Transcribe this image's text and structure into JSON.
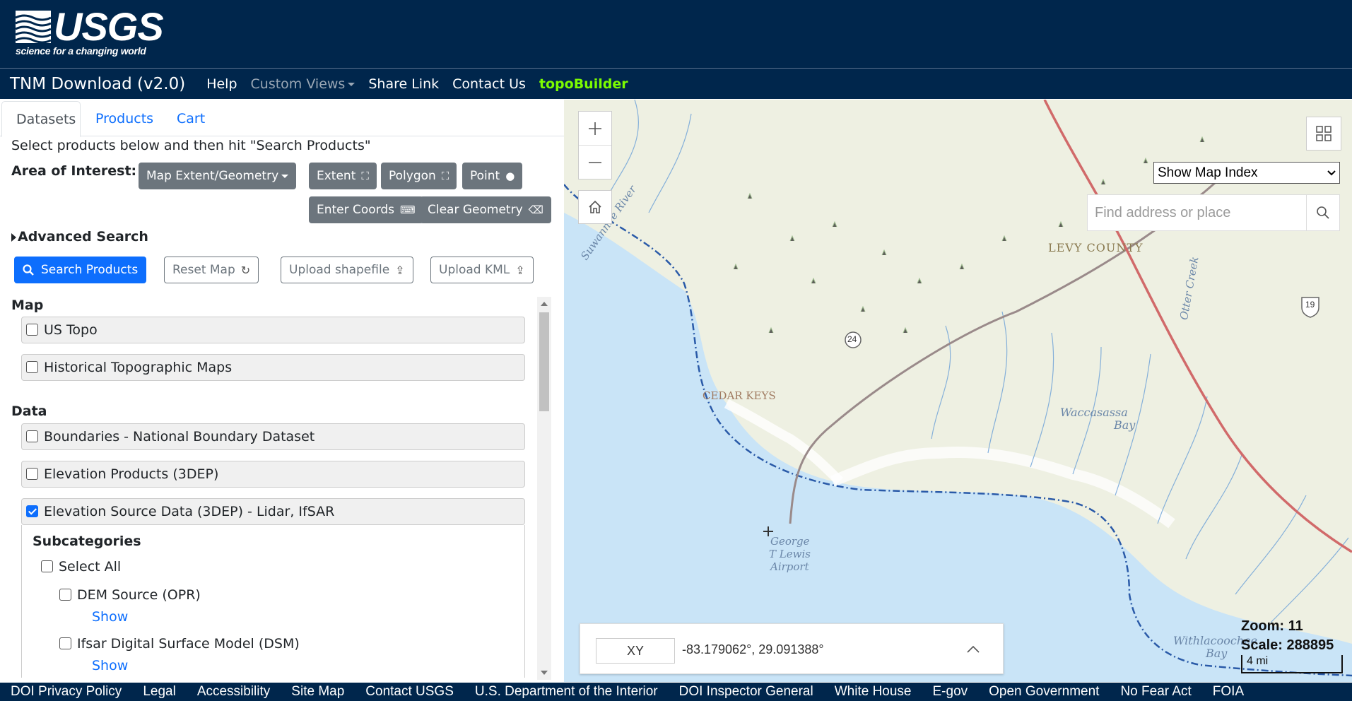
{
  "header": {
    "logo_text": "USGS",
    "tagline": "science for a changing world"
  },
  "navbar": {
    "brand": "TNM Download (v2.0)",
    "links": [
      {
        "label": "Help"
      },
      {
        "label": "Custom Views"
      },
      {
        "label": "Share Link"
      },
      {
        "label": "Contact Us"
      },
      {
        "label": "topoBuilder"
      }
    ]
  },
  "tabs": [
    {
      "label": "Datasets"
    },
    {
      "label": "Products"
    },
    {
      "label": "Cart"
    }
  ],
  "instructions": "Select products below and then hit \"Search Products\"",
  "aoi": {
    "label": "Area of Interest:",
    "buttons": {
      "map_extent": "Map Extent/Geometry",
      "extent": "Extent",
      "polygon": "Polygon",
      "point": "Point",
      "enter_coords": "Enter Coords",
      "clear_geometry": "Clear Geometry"
    }
  },
  "advanced_search": "Advanced Search",
  "actions": {
    "search": "Search Products",
    "reset": "Reset Map",
    "upload_shapefile": "Upload shapefile",
    "upload_kml": "Upload KML"
  },
  "sections": {
    "map_title": "Map",
    "map_items": [
      {
        "label": "US Topo",
        "checked": false
      },
      {
        "label": "Historical Topographic Maps",
        "checked": false
      }
    ],
    "data_title": "Data",
    "data_items": [
      {
        "label": "Boundaries - National Boundary Dataset",
        "checked": false
      },
      {
        "label": "Elevation Products (3DEP)",
        "checked": false
      },
      {
        "label": "Elevation Source Data (3DEP) - Lidar, IfSAR",
        "checked": true
      }
    ],
    "subcategories": {
      "title": "Subcategories",
      "select_all": "Select All",
      "items": [
        {
          "label": "DEM Source (OPR)",
          "show": "Show"
        },
        {
          "label": "Ifsar Digital Surface Model (DSM)",
          "show": "Show"
        }
      ]
    }
  },
  "map": {
    "index_select": "Show Map Index",
    "search_placeholder": "Find address or place",
    "coord_mode": "XY",
    "coords": "-83.179062°, 29.091388°",
    "zoom": "Zoom: 11",
    "scale": "Scale: 288895",
    "scalebar": "4 mi",
    "labels": {
      "levy": "LEVY COUNTY",
      "cedar": "CEDAR KEYS",
      "waccasassa1": "Waccasassa",
      "waccasassa2": "Bay",
      "airport1": "George",
      "airport2": "T Lewis",
      "airport3": "Airport",
      "otter": "Otter Creek",
      "suwannee": "Suwannee River",
      "withla1": "Withlacoochee",
      "withla2": "Bay",
      "road24": "24",
      "road19": "19"
    },
    "colors": {
      "water": "#c9e4f7",
      "land": "#eef0e2",
      "coast": "#2a5aa8",
      "hwy": "#d16a6a"
    }
  },
  "footer": [
    "DOI Privacy Policy",
    "Legal",
    "Accessibility",
    "Site Map",
    "Contact USGS",
    "U.S. Department of the Interior",
    "DOI Inspector General",
    "White House",
    "E-gov",
    "Open Government",
    "No Fear Act",
    "FOIA"
  ]
}
